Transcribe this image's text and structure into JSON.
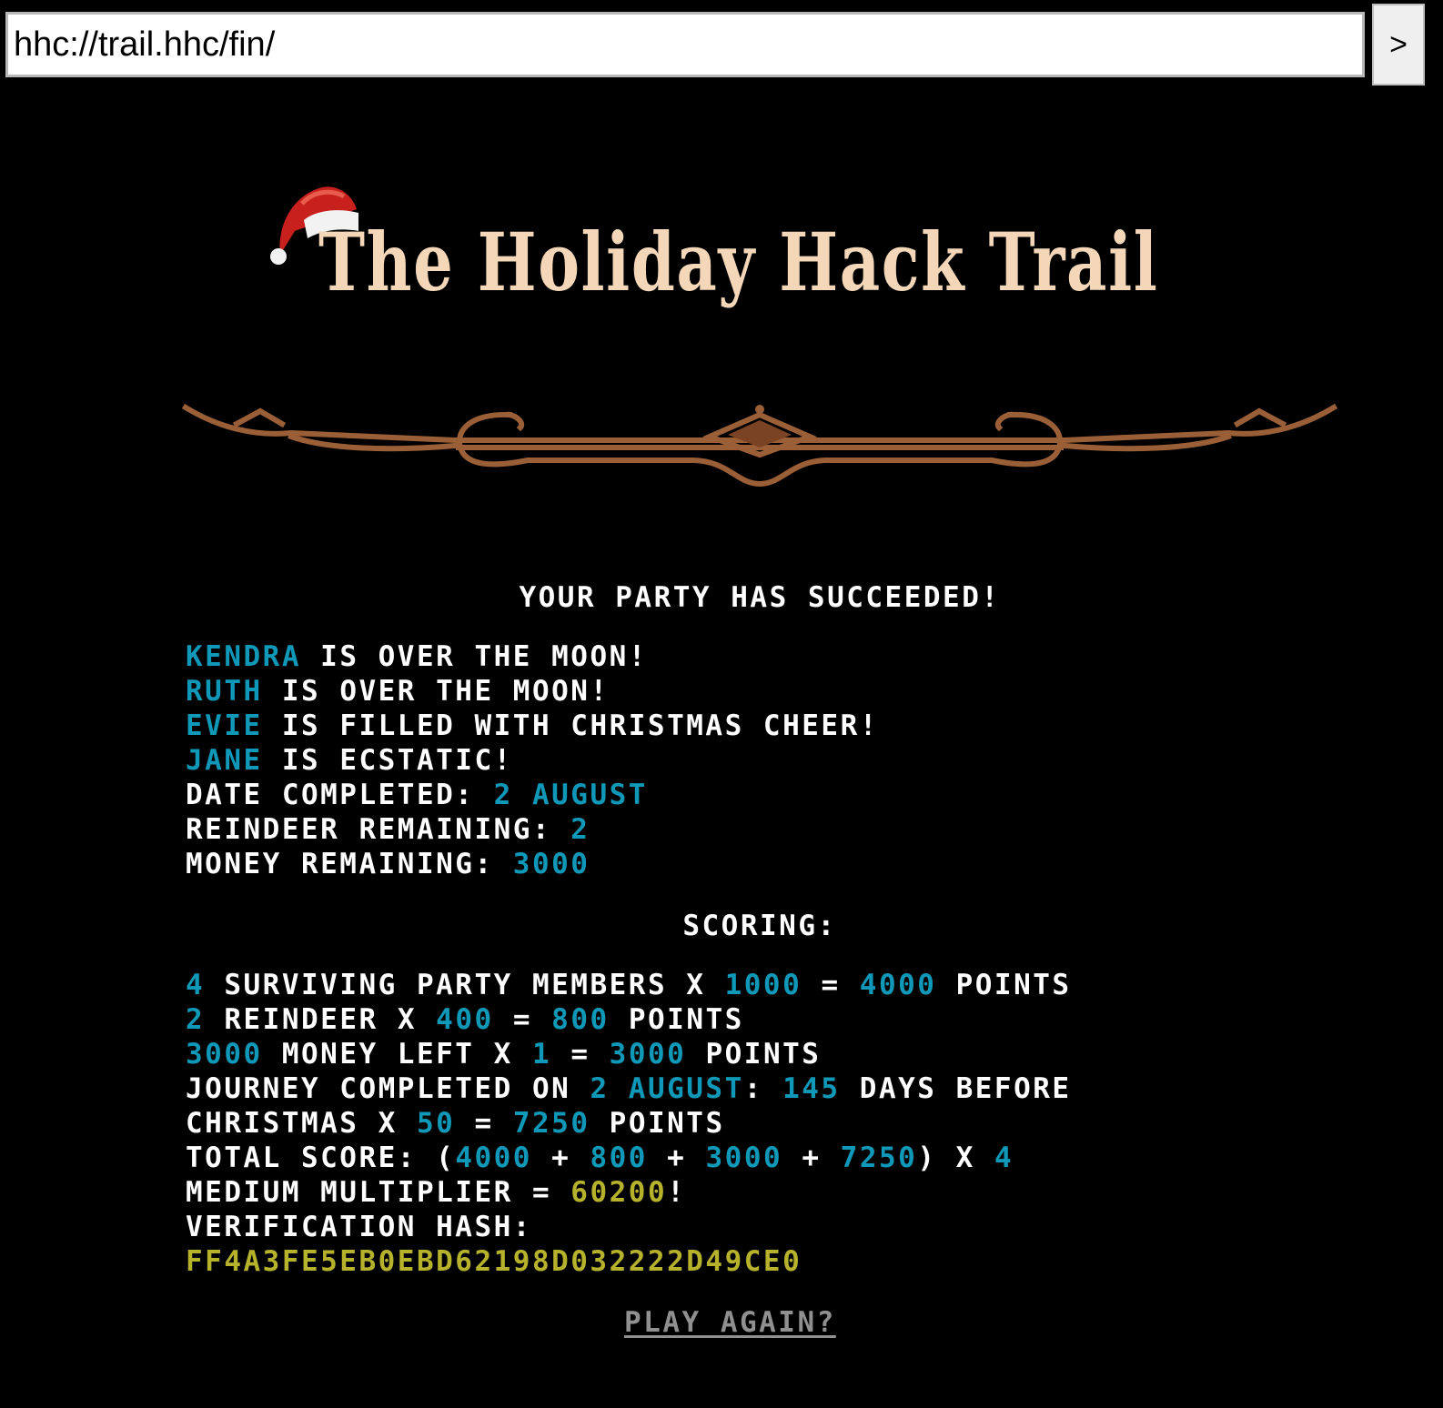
{
  "browser": {
    "url": "hhc://trail.hhc/fin/",
    "go_label": ">"
  },
  "header": {
    "title": "The Holiday Hack Trail"
  },
  "status": {
    "headline": "Your party has succeeded!",
    "members": [
      {
        "name": "Kendra",
        "state": "is over the moon!"
      },
      {
        "name": "Ruth",
        "state": "is over the moon!"
      },
      {
        "name": "Evie",
        "state": "is filled with Christmas cheer!"
      },
      {
        "name": "Jane",
        "state": "is ecstatic!"
      }
    ],
    "date_label": "Date completed:",
    "date_value": "2 August",
    "reindeer_label": "Reindeer remaining:",
    "reindeer_value": "2",
    "money_label": "Money remaining:",
    "money_value": "3000"
  },
  "scoring": {
    "heading": "Scoring:",
    "party": {
      "count": "4",
      "text1": "surviving party members x",
      "multiplier": "1000",
      "eq": "=",
      "result": "4000",
      "unit": "points"
    },
    "reindeer": {
      "count": "2",
      "text1": "reindeer x",
      "multiplier": "400",
      "eq": "=",
      "result": "800",
      "unit": "points"
    },
    "money": {
      "count": "3000",
      "text1": "money left x",
      "multiplier": "1",
      "eq": "=",
      "result": "3000",
      "unit": "points"
    },
    "journey": {
      "text1": "Journey completed on",
      "date": "2 August",
      "colon": ":",
      "days": "145",
      "text2": "days before",
      "text3": "Christmas x",
      "multiplier": "50",
      "eq": "=",
      "result": "7250",
      "unit": "points"
    },
    "total": {
      "label": "Total score:",
      "open": "(",
      "a": "4000",
      "plus1": "+",
      "b": "800",
      "plus2": "+",
      "c": "3000",
      "plus3": "+",
      "d": "7250",
      "close": ")",
      "x": "x",
      "mult": "4",
      "mult_label": "Medium multiplier",
      "eq": "=",
      "value": "60200",
      "bang": "!"
    },
    "hash_label": "Verification hash:",
    "hash_value": "FF4A3FE5EB0EBD62198D032222D49CE0"
  },
  "actions": {
    "play_again": "Play again?"
  },
  "colors": {
    "background": "#000000",
    "text": "#ffffff",
    "highlight": "#0f98b8",
    "score": "#b7b22c",
    "title": "#f4d7b8",
    "ornament": "#9a5f37"
  }
}
